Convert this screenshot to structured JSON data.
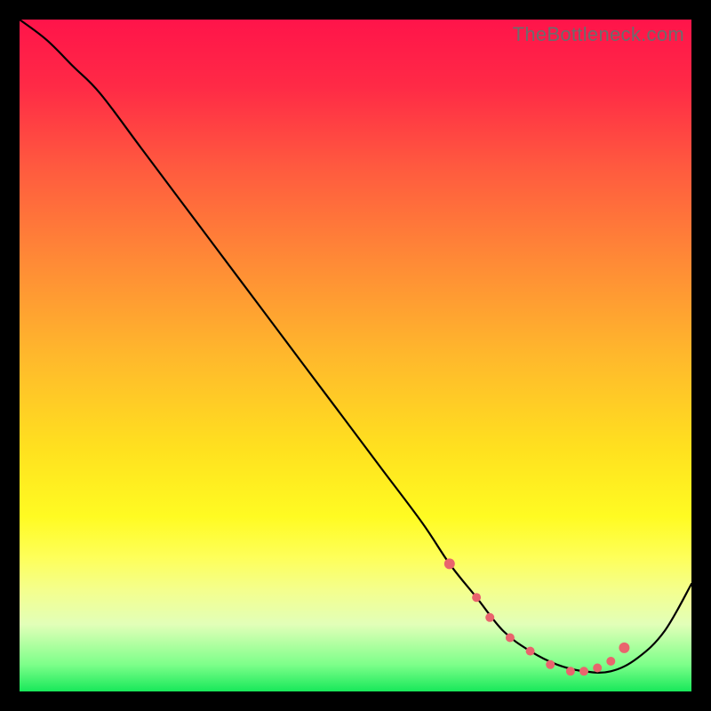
{
  "watermark": "TheBottleneck.com",
  "colors": {
    "line": "#000000",
    "marker": "#e9646d",
    "background_black": "#000000"
  },
  "chart_data": {
    "type": "line",
    "title": "",
    "xlabel": "",
    "ylabel": "",
    "xlim": [
      0,
      100
    ],
    "ylim": [
      0,
      100
    ],
    "series": [
      {
        "name": "curve",
        "x": [
          0,
          4,
          8,
          12,
          18,
          24,
          30,
          36,
          42,
          48,
          54,
          60,
          64,
          68,
          72,
          76,
          80,
          84,
          88,
          92,
          96,
          100
        ],
        "y": [
          100,
          97,
          93,
          89,
          81,
          73,
          65,
          57,
          49,
          41,
          33,
          25,
          19,
          14,
          9,
          6,
          4,
          3,
          3,
          5,
          9,
          16
        ]
      }
    ],
    "markers": {
      "name": "highlighted-points",
      "color": "#e9646d",
      "x": [
        64,
        68,
        70,
        73,
        76,
        79,
        82,
        84,
        86,
        88,
        90
      ],
      "y": [
        19,
        14,
        11,
        8,
        6,
        4,
        3,
        3,
        3.5,
        4.5,
        6.5
      ]
    }
  }
}
